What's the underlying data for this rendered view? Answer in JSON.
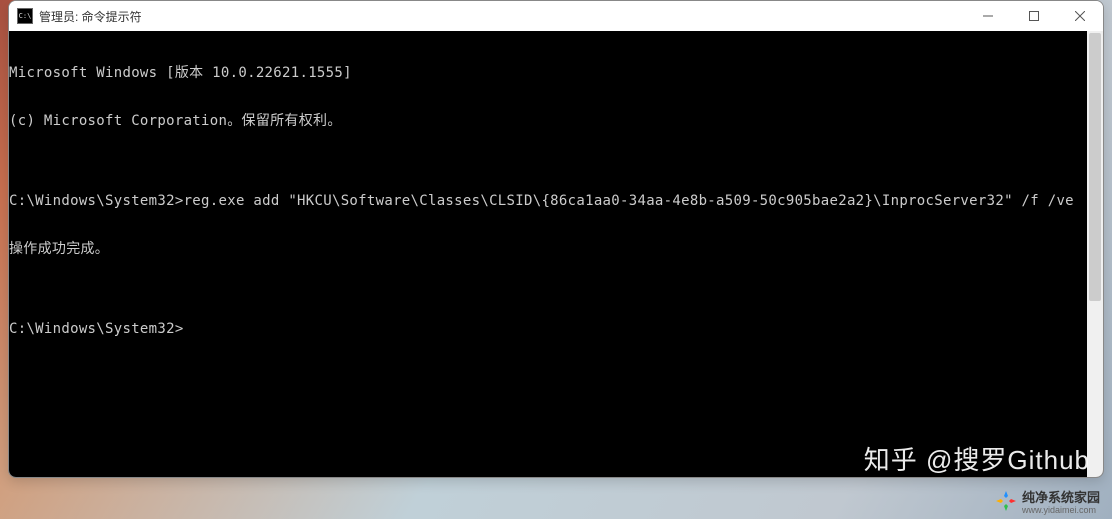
{
  "window": {
    "title": "管理员: 命令提示符"
  },
  "terminal": {
    "line1": "Microsoft Windows [版本 10.0.22621.1555]",
    "line2": "(c) Microsoft Corporation。保留所有权利。",
    "blank1": "",
    "line3": "C:\\Windows\\System32>reg.exe add \"HKCU\\Software\\Classes\\CLSID\\{86ca1aa0-34aa-4e8b-a509-50c905bae2a2}\\InprocServer32\" /f /ve",
    "line4": "操作成功完成。",
    "blank2": "",
    "line5": "C:\\Windows\\System32>"
  },
  "watermarks": {
    "zhihu": "知乎 @搜罗Github",
    "brand": "纯净系统家园",
    "url": "www.yidaimei.com"
  }
}
